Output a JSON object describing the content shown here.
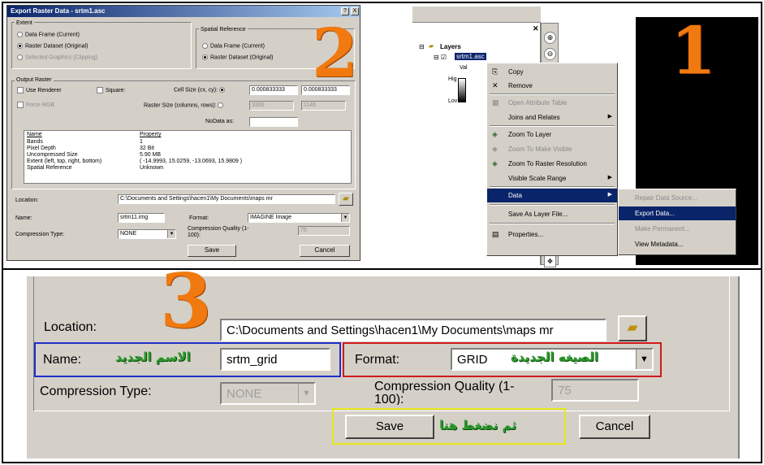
{
  "step_numbers": {
    "one": "1",
    "two": "2",
    "three": "3"
  },
  "dialog": {
    "title": "Export Raster Data - srtm1.asc",
    "title_buttons": [
      "?",
      "X"
    ],
    "extent": {
      "label": "Extent",
      "options": [
        "Data Frame (Current)",
        "Raster Dataset (Original)",
        "Selected Graphics (Clipping)"
      ],
      "selected": 1
    },
    "spatial_reference": {
      "label": "Spatial Reference",
      "options": [
        "Data Frame (Current)",
        "Raster Dataset (Original)"
      ],
      "selected": 1
    },
    "output_raster": {
      "label": "Output Raster",
      "use_renderer": "Use Renderer",
      "square": "Square:",
      "force_rgb": "Force RGB",
      "cell_size_label": "Cell Size (cx, cy):",
      "cell_size_x": "0.000833333",
      "cell_size_y": "0.000833333",
      "raster_size_label": "Raster Size (columns, rows):",
      "raster_cols": "3300",
      "raster_rows": "1146",
      "nodata_label": "NoData as:",
      "nodata_value": ""
    },
    "properties": {
      "header_name": "Name",
      "header_property": "Property",
      "rows": [
        {
          "name": "Bands",
          "value": "1"
        },
        {
          "name": "Pixel Depth",
          "value": "32 Bit"
        },
        {
          "name": "Uncompressed Size",
          "value": "5.90 MB"
        },
        {
          "name": "Extent (left, top, right, bottom)",
          "value": "( -14.9993, 15.0259, -13.0693, 15.9809 )"
        },
        {
          "name": "Spatial Reference",
          "value": "Unknown"
        }
      ]
    },
    "location_label": "Location:",
    "location_value": "C:\\Documents and Settings\\hacen1\\My Documents\\maps mr",
    "name_label": "Name:",
    "name_value": "srtm11.img",
    "format_label": "Format:",
    "format_value": "IMAGINE Image",
    "compression_type_label": "Compression Type:",
    "compression_type_value": "NONE",
    "compression_quality_label": "Compression Quality (1-100):",
    "compression_quality_value": "75",
    "save_label": "Save",
    "cancel_label": "Cancel"
  },
  "toc": {
    "layers_label": "Layers",
    "layer_name": "srtm1.asc",
    "legend_value": "Val",
    "legend_high": "Hig",
    "legend_low": "Lov"
  },
  "context_menu": {
    "items": [
      {
        "label": "Copy",
        "icon": "copy-icon",
        "glyph": "⎘"
      },
      {
        "label": "Remove",
        "icon": "remove-icon",
        "glyph": "✕"
      },
      {
        "label": "Open Attribute Table",
        "icon": "table-icon",
        "glyph": "▦"
      },
      {
        "label": "Joins and Relates",
        "icon": "",
        "glyph": ""
      },
      {
        "label": "Zoom To Layer",
        "icon": "zoom-layer-icon",
        "glyph": "◈"
      },
      {
        "label": "Zoom To Make Visible",
        "icon": "zoom-visible-icon",
        "glyph": "◈"
      },
      {
        "label": "Zoom To Raster Resolution",
        "icon": "zoom-raster-icon",
        "glyph": "◈"
      },
      {
        "label": "Visible Scale Range",
        "icon": "",
        "glyph": ""
      },
      {
        "label": "Data",
        "icon": "",
        "glyph": ""
      },
      {
        "label": "Save As Layer File...",
        "icon": "",
        "glyph": ""
      },
      {
        "label": "Properties...",
        "icon": "properties-icon",
        "glyph": "▤"
      }
    ]
  },
  "data_submenu": {
    "items": [
      "Repair Data Source...",
      "Export Data...",
      "Make Permanent...",
      "View Metadata..."
    ]
  },
  "zoomed": {
    "location_label": "Location:",
    "location_value": "C:\\Documents and Settings\\hacen1\\My Documents\\maps mr",
    "name_label": "Name:",
    "name_value": "srtm_grid",
    "name_annotation": "الاسم الجديد",
    "format_label": "Format:",
    "format_value": "GRID",
    "format_annotation": "الصيغه الجديدة",
    "compression_type_label": "Compression Type:",
    "compression_type_value": "NONE",
    "compression_quality_label": "Compression Quality (1-100):",
    "compression_quality_value": "75",
    "save_label": "Save",
    "save_annotation": "ثم نضغط هنا",
    "cancel_label": "Cancel"
  },
  "colors": {
    "step_orange": "#f07a10",
    "annotation_green": "#2e9a2e",
    "name_box": "#1f2fc8",
    "format_box": "#d01a1a",
    "save_box": "#e8e81a",
    "menu_highlight": "#0a246a"
  }
}
